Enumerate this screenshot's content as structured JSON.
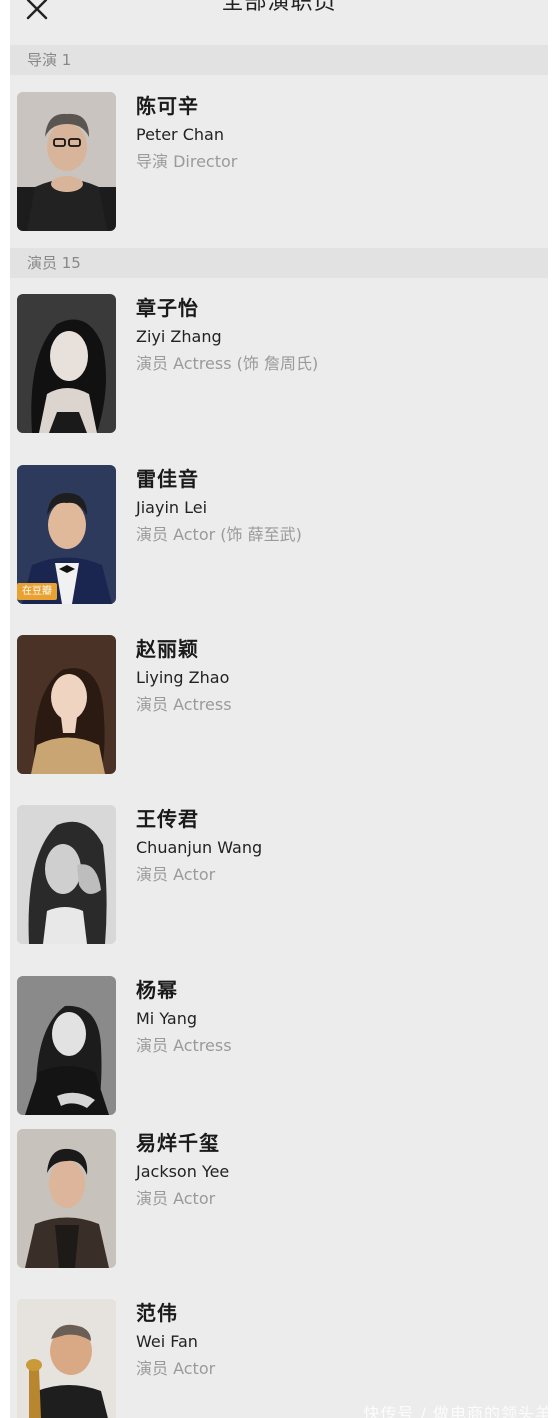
{
  "header": {
    "title": "全部演职员",
    "close_icon": "close-icon"
  },
  "sections": [
    {
      "label": "导演 1"
    },
    {
      "label": "演员 15"
    }
  ],
  "people": [
    {
      "name_cn": "陈可辛",
      "name_en": "Peter Chan",
      "role": "导演 Director"
    },
    {
      "name_cn": "章子怡",
      "name_en": "Ziyi Zhang",
      "role": "演员 Actress (饰 詹周氏)"
    },
    {
      "name_cn": "雷佳音",
      "name_en": "Jiayin Lei",
      "role": "演员 Actor (饰 薛至武)",
      "badge": "在豆瓣"
    },
    {
      "name_cn": "赵丽颖",
      "name_en": "Liying Zhao",
      "role": "演员 Actress"
    },
    {
      "name_cn": "王传君",
      "name_en": "Chuanjun Wang",
      "role": "演员 Actor"
    },
    {
      "name_cn": "杨幂",
      "name_en": "Mi Yang",
      "role": "演员 Actress"
    },
    {
      "name_cn": "易烊千玺",
      "name_en": "Jackson Yee",
      "role": "演员 Actor"
    },
    {
      "name_cn": "范伟",
      "name_en": "Wei Fan",
      "role": "演员 Actor"
    }
  ],
  "watermark": "快传号 / 做电商的领头羊",
  "colors": {
    "background": "#ececec",
    "section_bar": "#e2e2e2",
    "badge": "#e9a132",
    "role_text": "#9a9a9a"
  }
}
